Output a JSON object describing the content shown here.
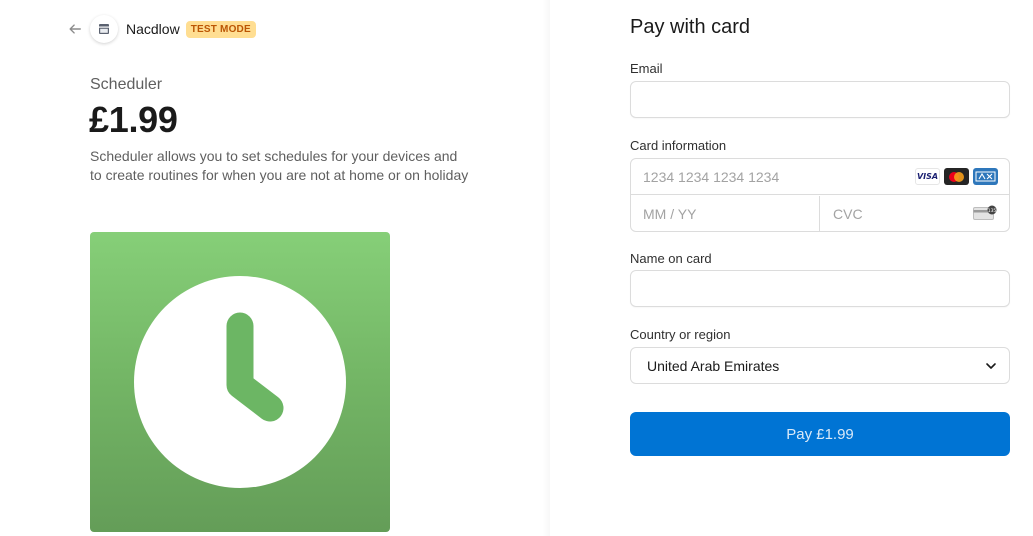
{
  "merchant": {
    "name": "Nacdlow",
    "badge": "TEST MODE"
  },
  "product": {
    "name": "Scheduler",
    "price": "£1.99",
    "description": "Scheduler allows you to set schedules for your devices and to create routines for when you are not at home or on holiday",
    "image_icon": "clock-icon",
    "image_colors": {
      "top": "#86cf78",
      "bottom": "#649d58"
    }
  },
  "payment": {
    "title": "Pay with card",
    "email": {
      "label": "Email",
      "value": "",
      "placeholder": ""
    },
    "card": {
      "label": "Card information",
      "number_placeholder": "1234 1234 1234 1234",
      "expiry_placeholder": "MM / YY",
      "cvc_placeholder": "CVC",
      "brands": [
        "VISA",
        "mastercard",
        "AMEX"
      ]
    },
    "name_on_card": {
      "label": "Name on card",
      "value": "",
      "placeholder": ""
    },
    "country": {
      "label": "Country or region",
      "selected": "United Arab Emirates"
    },
    "pay_button": "Pay £1.99"
  },
  "colors": {
    "accent": "#0074d4",
    "badge_bg": "#ffde92",
    "badge_text": "#bb5504"
  }
}
